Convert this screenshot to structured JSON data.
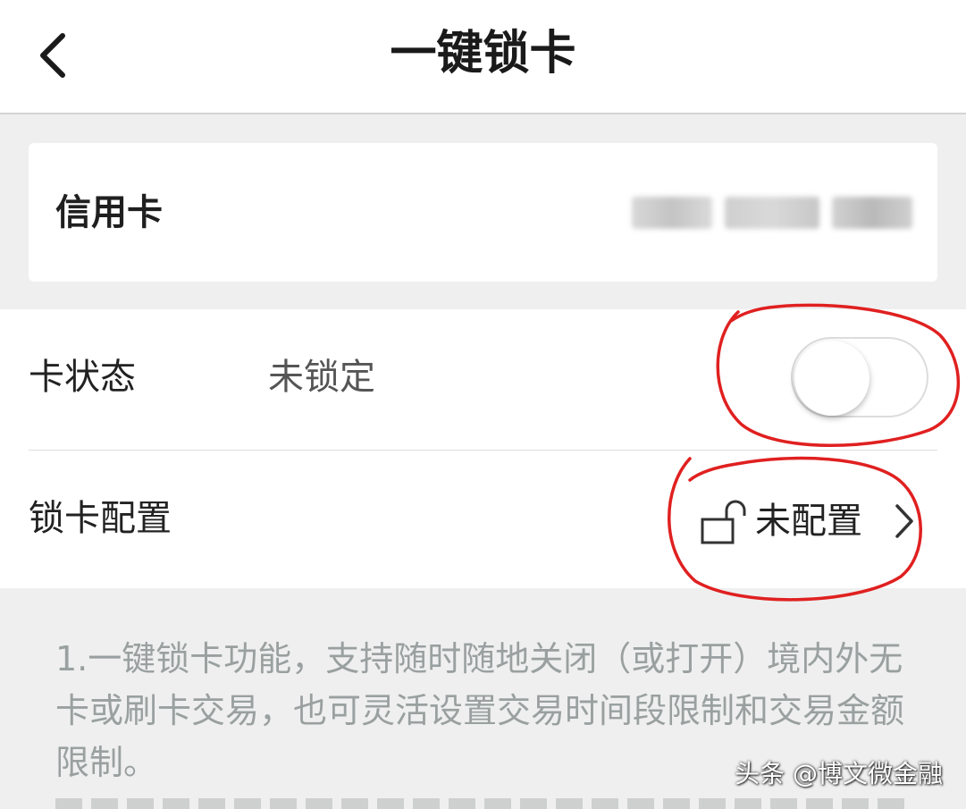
{
  "header": {
    "title": "一键锁卡",
    "back_icon": "chevron-left-icon"
  },
  "card": {
    "label": "信用卡",
    "number_masked": "blurred card number"
  },
  "status_row": {
    "label": "卡状态",
    "value": "未锁定",
    "toggle_on": false
  },
  "config_row": {
    "label": "锁卡配置",
    "lock_icon": "unlocked-padlock-icon",
    "value": "未配置",
    "chevron_icon": "chevron-right-icon"
  },
  "description": {
    "text": "1.一键锁卡功能，支持随时随地关闭（或打开）境内外无卡或刷卡交易，也可灵活设置交易时间段限制和交易金额限制。"
  },
  "watermark": {
    "text": "头条 @博文微金融"
  },
  "colors": {
    "background": "#efefef",
    "panel": "#ffffff",
    "annotation_red": "#e02020",
    "muted_text": "#9aa0a0"
  }
}
